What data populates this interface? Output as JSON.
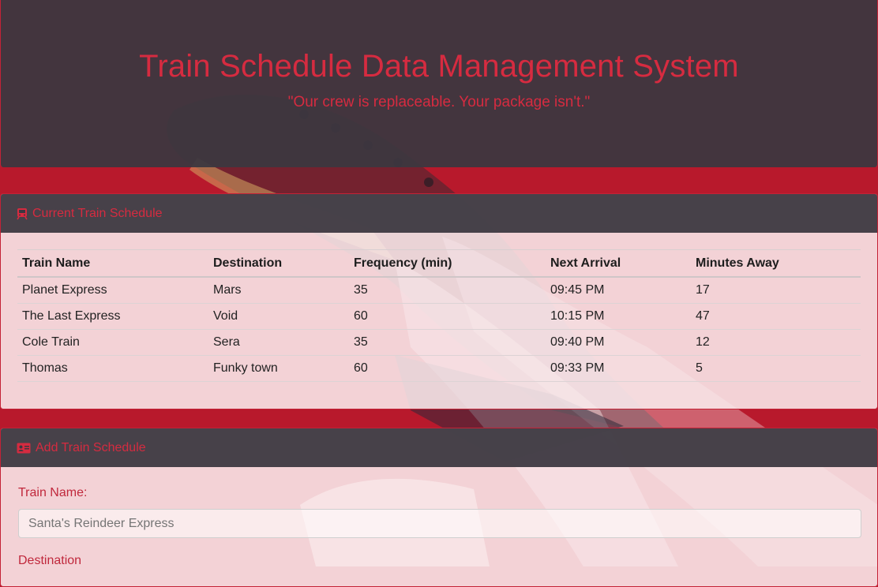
{
  "header": {
    "title": "Train Schedule Data Management System",
    "tagline": "\"Our crew is replaceable. Your package isn't.\""
  },
  "schedule_card": {
    "title": "Current Train Schedule",
    "icon": "train-icon",
    "columns": [
      "Train Name",
      "Destination",
      "Frequency (min)",
      "Next Arrival",
      "Minutes Away"
    ],
    "rows": [
      [
        "Planet Express",
        "Mars",
        "35",
        "09:45 PM",
        "17"
      ],
      [
        "The Last Express",
        "Void",
        "60",
        "10:15 PM",
        "47"
      ],
      [
        "Cole Train",
        "Sera",
        "35",
        "09:40 PM",
        "12"
      ],
      [
        "Thomas",
        "Funky town",
        "60",
        "09:33 PM",
        "5"
      ]
    ]
  },
  "add_card": {
    "title": "Add Train Schedule",
    "icon": "id-card-icon",
    "train_name_label": "Train Name:",
    "train_name_placeholder": "Santa's Reindeer Express",
    "destination_label": "Destination"
  },
  "colors": {
    "accent": "#d62b40",
    "background": "#b8192c",
    "panel": "#3c3740"
  }
}
